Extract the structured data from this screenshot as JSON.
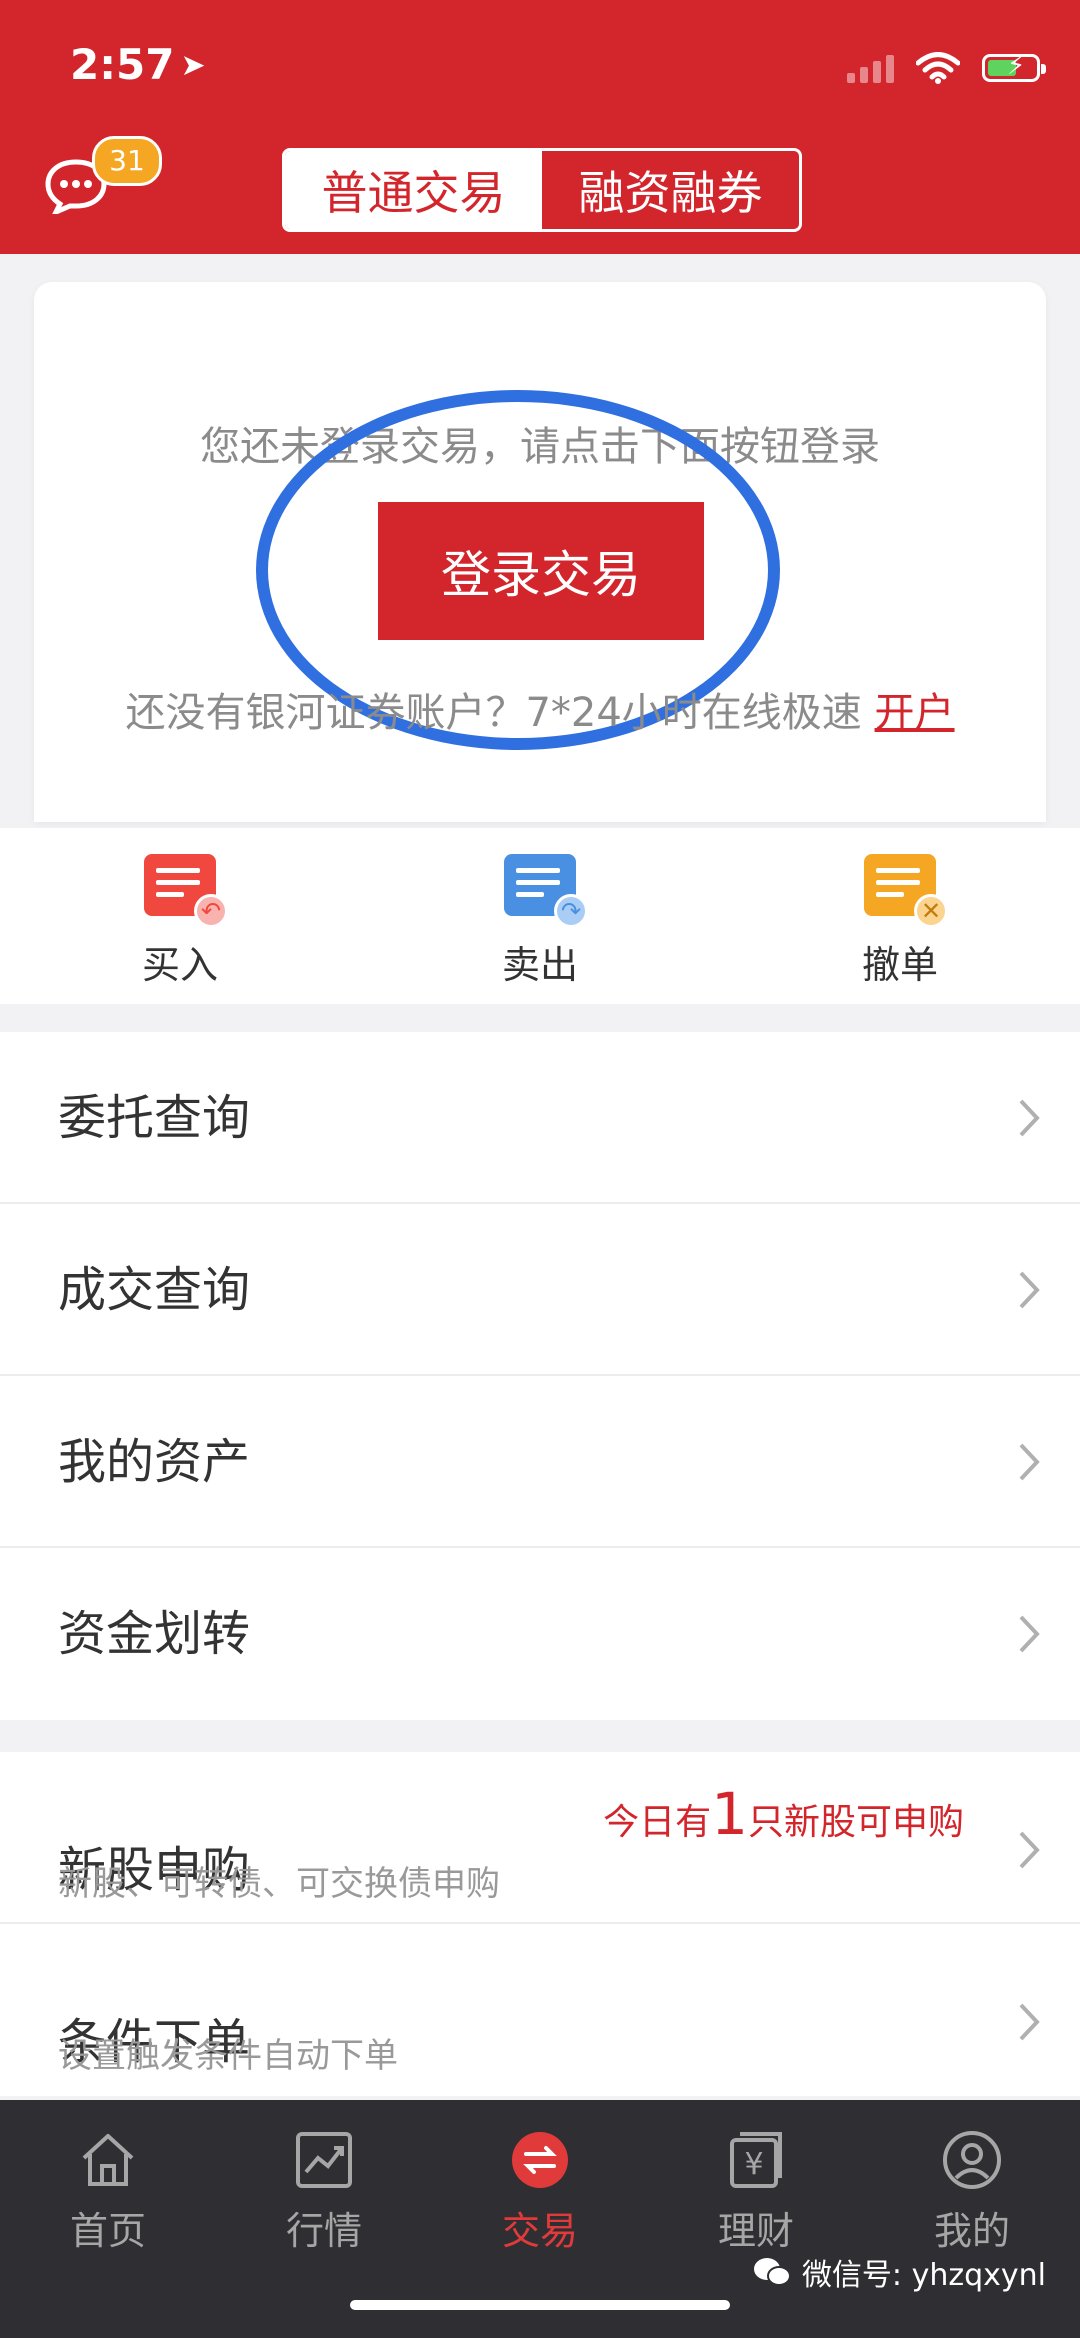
{
  "status_bar": {
    "time": "2:57"
  },
  "header": {
    "message_badge": "31",
    "segments": [
      "普通交易",
      "融资融券"
    ]
  },
  "login": {
    "prompt": "您还未登录交易，请点击下面按钮登录",
    "button": "登录交易",
    "open_account_text": "还没有银河证券账户？7*24小时在线极速",
    "open_account_link": "开户"
  },
  "actions": [
    {
      "label": "买入",
      "icon": "buy-icon",
      "color": "#f0483e",
      "sub": "↶"
    },
    {
      "label": "卖出",
      "icon": "sell-icon",
      "color": "#4a90e2",
      "sub": "↷"
    },
    {
      "label": "撤单",
      "icon": "cancel-order-icon",
      "color": "#f5a623",
      "sub": "✕"
    }
  ],
  "menu": [
    {
      "label": "委托查询"
    },
    {
      "label": "成交查询"
    },
    {
      "label": "我的资产"
    },
    {
      "label": "资金划转"
    }
  ],
  "menu2": [
    {
      "label": "新股申购",
      "desc": "新股、可转债、可交换债申购",
      "promo_prefix": "今日有",
      "promo_count": "1",
      "promo_suffix": "只新股可申购"
    },
    {
      "label": "条件下单",
      "desc": "设置触发条件自动下单"
    }
  ],
  "tabbar": [
    {
      "label": "首页",
      "icon": "home-icon"
    },
    {
      "label": "行情",
      "icon": "chart-icon"
    },
    {
      "label": "交易",
      "icon": "trade-icon",
      "active": true
    },
    {
      "label": "理财",
      "icon": "finance-icon"
    },
    {
      "label": "我的",
      "icon": "profile-icon"
    }
  ],
  "watermark": "微信号: yhzqxynl",
  "colors": {
    "brand_red": "#d3262c",
    "highlight_blue": "#2f6fe0"
  }
}
